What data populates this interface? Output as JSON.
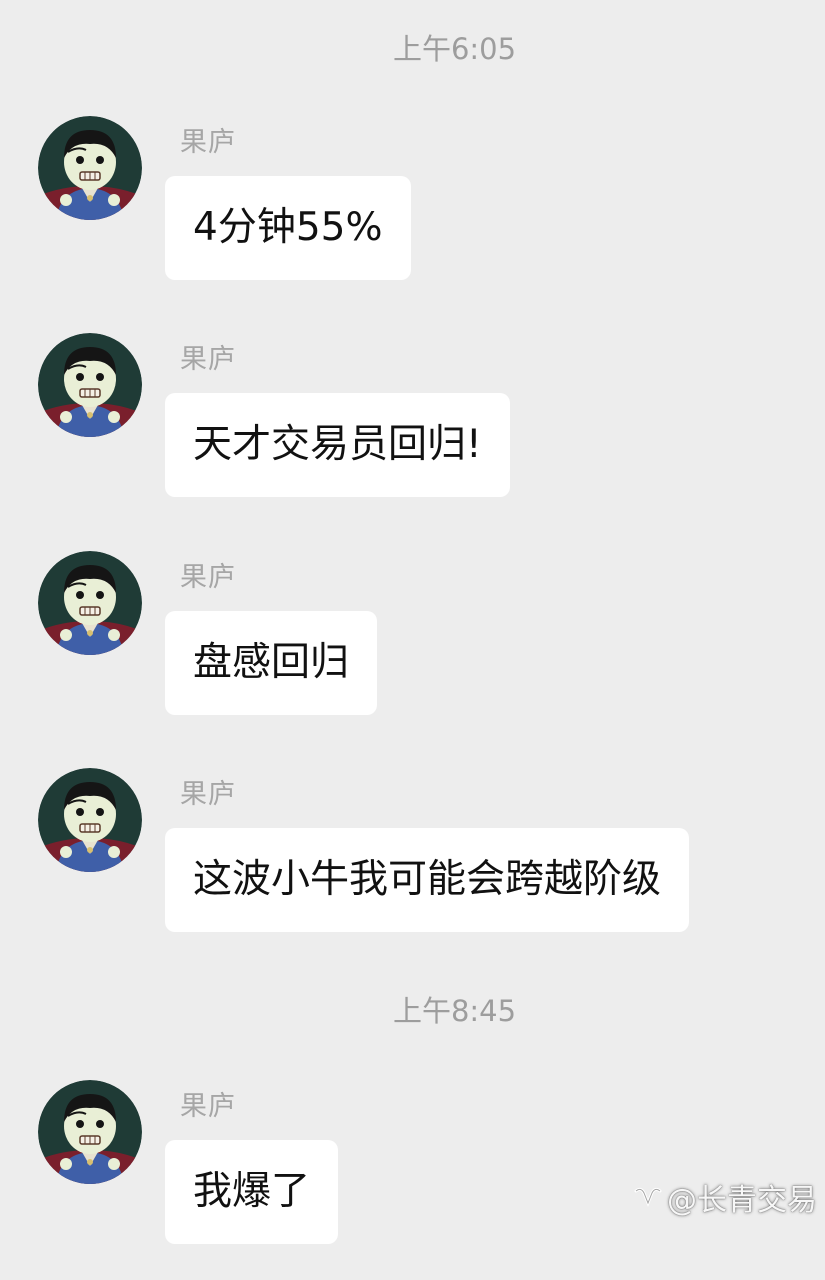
{
  "timestamps": [
    "上午6:05",
    "上午8:45"
  ],
  "messages": [
    {
      "sender": "果庐",
      "text": "4分钟55%"
    },
    {
      "sender": "果庐",
      "text": "天才交易员回归!"
    },
    {
      "sender": "果庐",
      "text": "盘感回归"
    },
    {
      "sender": "果庐",
      "text": "这波小牛我可能会跨越阶级"
    },
    {
      "sender": "果庐",
      "text": "我爆了"
    }
  ],
  "watermark": {
    "text": "@长青交易",
    "icon": "wechat-channel-icon"
  },
  "colors": {
    "background": "#ededed",
    "bubble": "#ffffff",
    "timestamp": "#9d9d9d",
    "sender": "#a6a6a6"
  }
}
